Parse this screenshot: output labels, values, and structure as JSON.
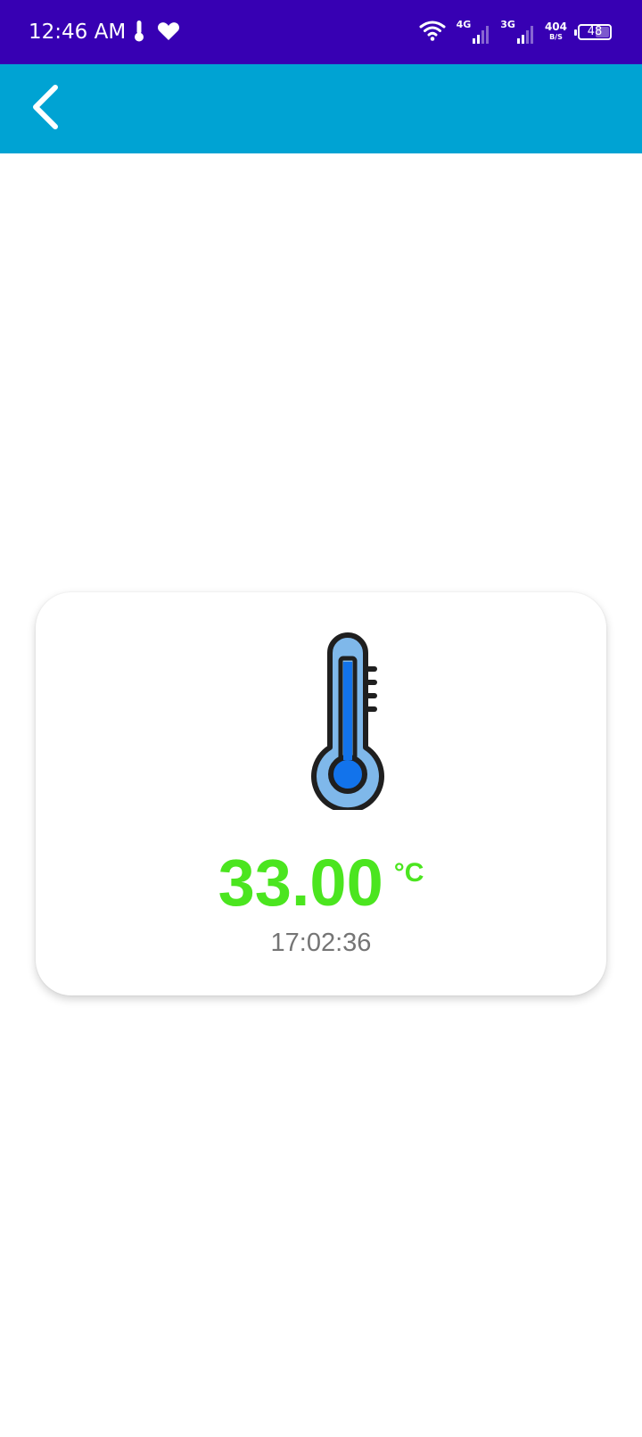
{
  "status_bar": {
    "time": "12:46 AM",
    "background": "#3700b3",
    "left_icons": [
      "thermometer-icon",
      "heart-icon"
    ],
    "right_icons": [
      "wifi-icon",
      "signal-4g-icon",
      "signal-3g-icon",
      "battery-icon"
    ],
    "network_1": "4G",
    "network_2": "3G",
    "speed_value": "404",
    "speed_unit": "B/S",
    "battery_level": "48"
  },
  "app_bar": {
    "background": "#00a3d3",
    "back_icon": "chevron-left-icon"
  },
  "reading_card": {
    "icon": "thermometer-icon",
    "temperature": "33.00",
    "unit": "°C",
    "time": "17:02:36",
    "value_color": "#4be51f",
    "time_color": "#757575"
  }
}
